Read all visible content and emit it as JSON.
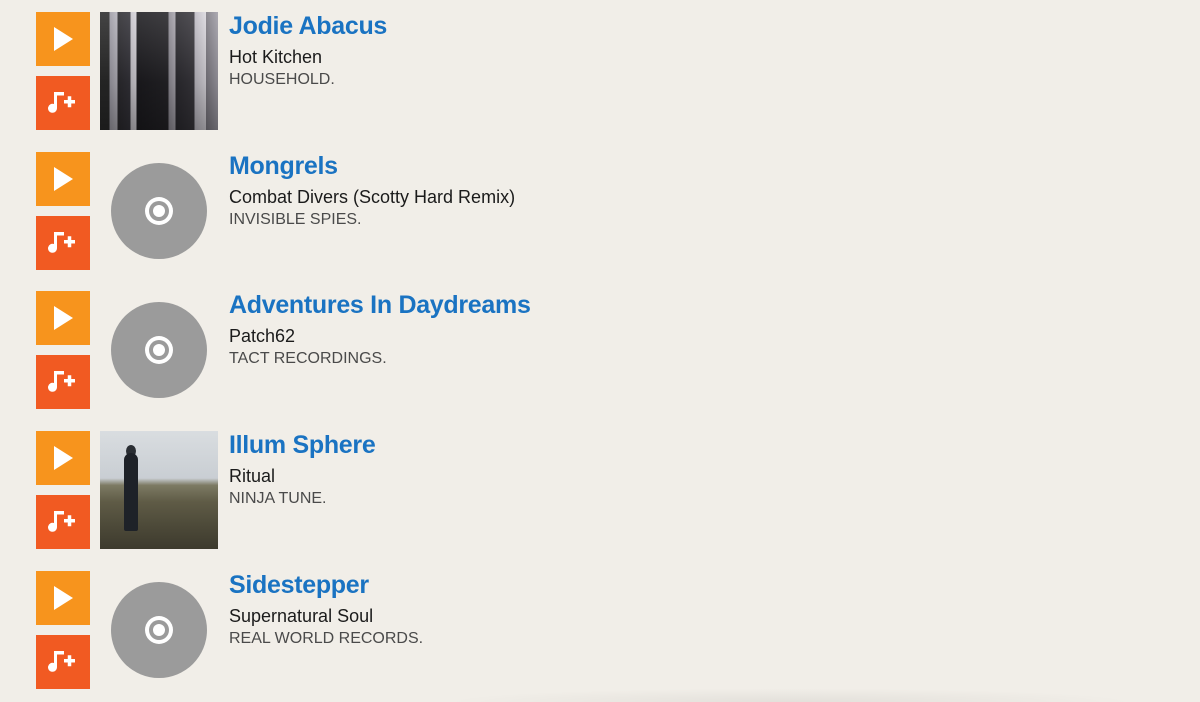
{
  "tracks": [
    {
      "artist": "Jodie Abacus",
      "title": "Hot Kitchen",
      "label": "HOUSEHOLD.",
      "artwork": "photo-portrait"
    },
    {
      "artist": "Mongrels",
      "title": "Combat Divers (Scotty Hard Remix)",
      "label": "INVISIBLE SPIES.",
      "artwork": "disc-placeholder-icon"
    },
    {
      "artist": "Adventures In Daydreams",
      "title": "Patch62",
      "label": "TACT RECORDINGS.",
      "artwork": "disc-placeholder-icon"
    },
    {
      "artist": "Illum Sphere",
      "title": "Ritual",
      "label": "NINJA TUNE.",
      "artwork": "photo-landscape-figure"
    },
    {
      "artist": "Sidestepper",
      "title": "Supernatural Soul",
      "label": "REAL WORLD RECORDS.",
      "artwork": "disc-placeholder-icon"
    }
  ],
  "icons": {
    "play": "play-icon",
    "add": "add-to-playlist-icon"
  },
  "colors": {
    "play_button": "#f7941d",
    "add_button": "#f15a22",
    "artist_link": "#1a73c2",
    "background": "#f1eee8",
    "disc": "#9b9b9b"
  }
}
